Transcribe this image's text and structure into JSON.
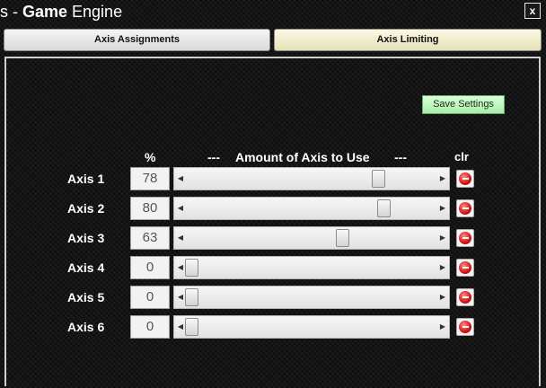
{
  "window": {
    "title_prefix": "s - ",
    "title_bold": "Game",
    "title_rest": " Engine",
    "close_label": "x"
  },
  "tabs": [
    {
      "label": "Axis Assignments",
      "active": false
    },
    {
      "label": "Axis Limiting",
      "active": true
    }
  ],
  "panel": {
    "save_label": "Save Settings",
    "header_percent": "%",
    "header_dash_left": "---",
    "header_amount": "Amount of Axis to Use",
    "header_dash_right": "---",
    "header_clr": "clr",
    "axes": [
      {
        "label": "Axis 1",
        "value": "78",
        "percent": 78
      },
      {
        "label": "Axis 2",
        "value": "80",
        "percent": 80
      },
      {
        "label": "Axis 3",
        "value": "63",
        "percent": 63
      },
      {
        "label": "Axis 4",
        "value": "0",
        "percent": 0
      },
      {
        "label": "Axis 5",
        "value": "0",
        "percent": 0
      },
      {
        "label": "Axis 6",
        "value": "0",
        "percent": 0
      }
    ]
  },
  "colors": {
    "active_tab_bg": "#f1eecb",
    "save_button_bg": "#c2f5c2",
    "clear_icon_red": "#d11414"
  },
  "icons": {
    "close": "close-icon",
    "clear": "clear-red-circle-icon",
    "slider_left": "arrow-left-icon",
    "slider_right": "arrow-right-icon"
  }
}
